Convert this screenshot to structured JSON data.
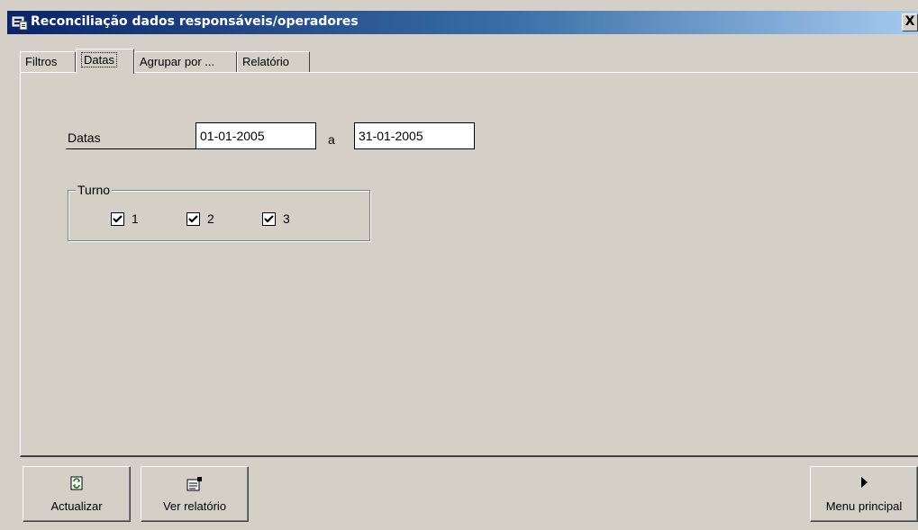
{
  "window": {
    "title": "Reconciliação dados responsáveis/operadores",
    "close_label": "X"
  },
  "tabs": [
    {
      "label": "Filtros",
      "active": false
    },
    {
      "label": "Datas",
      "active": true
    },
    {
      "label": "Agrupar por ...",
      "active": false
    },
    {
      "label": "Relatório",
      "active": false
    }
  ],
  "datas": {
    "label": "Datas",
    "from": "01-01-2005",
    "separator": "a",
    "to": "31-01-2005"
  },
  "turno": {
    "legend": "Turno",
    "options": [
      {
        "label": "1",
        "checked": true
      },
      {
        "label": "2",
        "checked": true
      },
      {
        "label": "3",
        "checked": true
      }
    ]
  },
  "buttons": {
    "actualizar": "Actualizar",
    "ver_relatorio": "Ver relatório",
    "menu_principal": "Menu principal"
  },
  "colors": {
    "titlebar_start": "#0a246a",
    "titlebar_end": "#a6caf0",
    "face": "#d4d0c8"
  }
}
